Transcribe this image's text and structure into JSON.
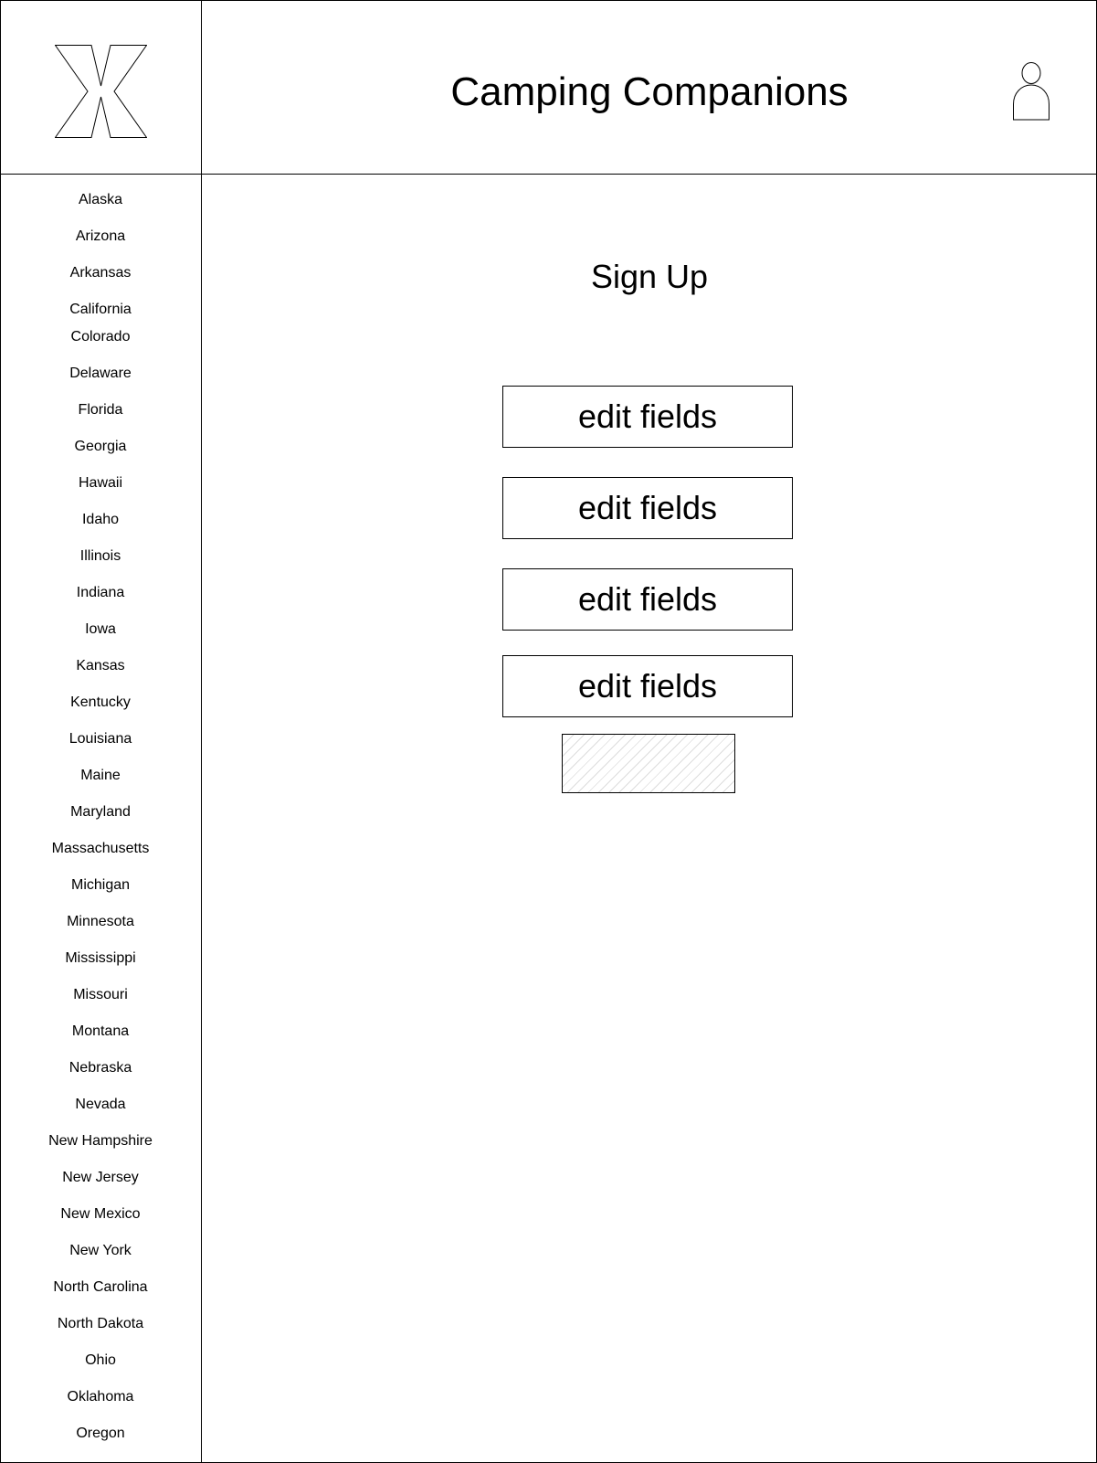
{
  "header": {
    "title": "Camping Companions",
    "logo_icon": "x-logo-icon",
    "user_icon": "user-avatar-icon"
  },
  "sidebar": {
    "items": [
      {
        "label": "Alaska"
      },
      {
        "label": "Arizona"
      },
      {
        "label": "Arkansas"
      },
      {
        "label": "California"
      },
      {
        "label": "Colorado"
      },
      {
        "label": "Delaware"
      },
      {
        "label": "Florida"
      },
      {
        "label": "Georgia"
      },
      {
        "label": "Hawaii"
      },
      {
        "label": "Idaho"
      },
      {
        "label": "Illinois"
      },
      {
        "label": "Indiana"
      },
      {
        "label": "Iowa"
      },
      {
        "label": "Kansas"
      },
      {
        "label": "Kentucky"
      },
      {
        "label": "Louisiana"
      },
      {
        "label": "Maine"
      },
      {
        "label": "Maryland"
      },
      {
        "label": "Massachusetts"
      },
      {
        "label": "Michigan"
      },
      {
        "label": "Minnesota"
      },
      {
        "label": "Mississippi"
      },
      {
        "label": "Missouri"
      },
      {
        "label": "Montana"
      },
      {
        "label": "Nebraska"
      },
      {
        "label": "Nevada"
      },
      {
        "label": "New Hampshire"
      },
      {
        "label": "New Jersey"
      },
      {
        "label": "New Mexico"
      },
      {
        "label": "New York"
      },
      {
        "label": "North Carolina"
      },
      {
        "label": "North Dakota"
      },
      {
        "label": "Ohio"
      },
      {
        "label": "Oklahoma"
      },
      {
        "label": "Oregon"
      }
    ]
  },
  "main": {
    "heading": "Sign Up",
    "fields": [
      {
        "label": "edit fields"
      },
      {
        "label": "edit fields"
      },
      {
        "label": "edit fields"
      },
      {
        "label": "edit fields"
      }
    ],
    "submit_placeholder": "image-placeholder"
  }
}
